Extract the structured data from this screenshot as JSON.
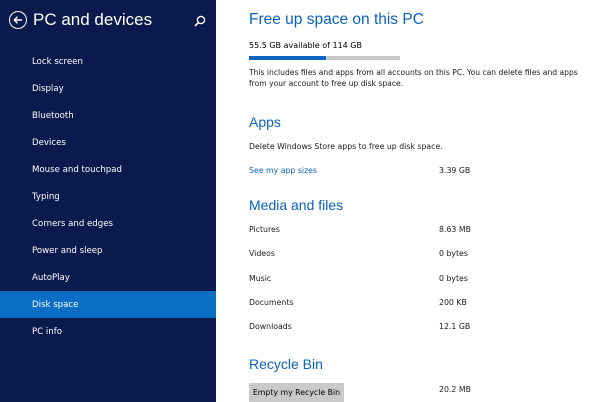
{
  "sidebar": {
    "title": "PC and devices",
    "items": [
      {
        "label": "Lock screen",
        "active": false
      },
      {
        "label": "Display",
        "active": false
      },
      {
        "label": "Bluetooth",
        "active": false
      },
      {
        "label": "Devices",
        "active": false
      },
      {
        "label": "Mouse and touchpad",
        "active": false
      },
      {
        "label": "Typing",
        "active": false
      },
      {
        "label": "Corners and edges",
        "active": false
      },
      {
        "label": "Power and sleep",
        "active": false
      },
      {
        "label": "AutoPlay",
        "active": false
      },
      {
        "label": "Disk space",
        "active": true
      },
      {
        "label": "PC info",
        "active": false
      }
    ]
  },
  "main": {
    "title": "Free up space on this PC",
    "available": "55.5 GB available of 114 GB",
    "usage_fraction": 0.513,
    "description": "This includes files and apps from all accounts on this PC. You can delete files and apps from your account to free up disk space.",
    "apps": {
      "heading": "Apps",
      "text": "Delete Windows Store apps to free up disk space.",
      "link": "See my app sizes",
      "size": "3.39 GB"
    },
    "media": {
      "heading": "Media and files",
      "rows": [
        {
          "label": "Pictures",
          "value": "8.63 MB"
        },
        {
          "label": "Videos",
          "value": "0 bytes"
        },
        {
          "label": "Music",
          "value": "0 bytes"
        },
        {
          "label": "Documents",
          "value": "200 KB"
        },
        {
          "label": "Downloads",
          "value": "12.1 GB"
        }
      ]
    },
    "recycle": {
      "heading": "Recycle Bin",
      "button": "Empty my Recycle Bin",
      "size": "20.2 MB"
    }
  },
  "colors": {
    "sidebar_bg": "#0a1a4c",
    "selected": "#0a6ec5",
    "accent": "#0a62be"
  }
}
